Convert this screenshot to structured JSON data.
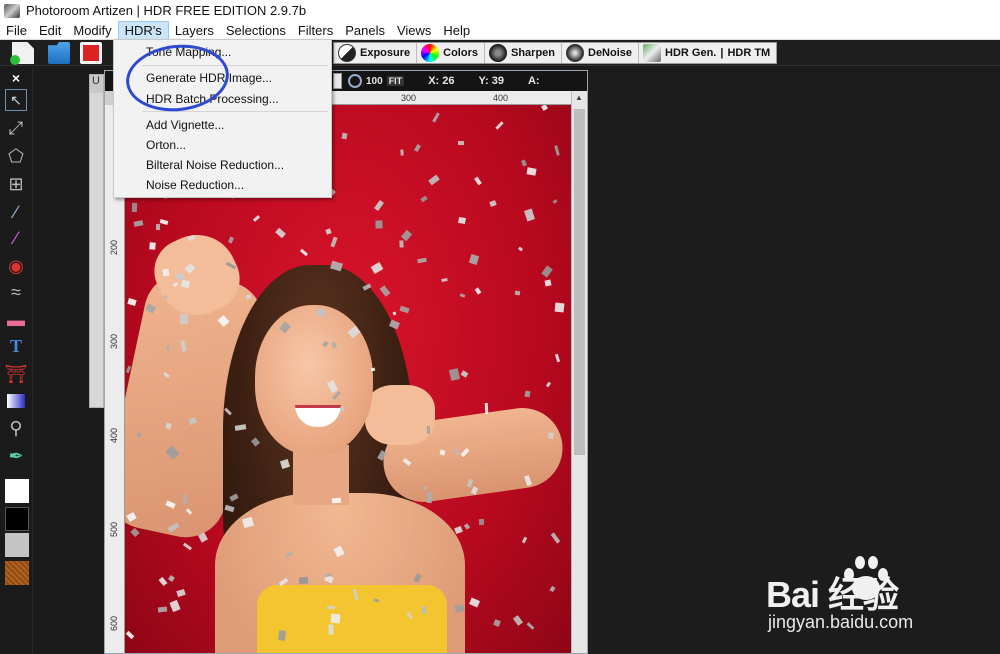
{
  "window": {
    "title": "Photoroom Artizen | HDR FREE EDITION 2.9.7b"
  },
  "menubar": {
    "items": [
      "File",
      "Edit",
      "Modify",
      "HDR's",
      "Layers",
      "Selections",
      "Filters",
      "Panels",
      "Views",
      "Help"
    ],
    "active": "HDR's"
  },
  "hdr_menu": {
    "items": [
      "Tone Mapping...",
      "Generate HDR Image...",
      "HDR Batch Processing...",
      "Add Vignette...",
      "Orton...",
      "Bilteral Noise Reduction...",
      "Noise Reduction..."
    ],
    "highlighted": "Generate HDR Image..."
  },
  "adjustments": {
    "exposure": "Exposure",
    "colors": "Colors",
    "sharpen": "Sharpen",
    "denoise": "DeNoise",
    "hdr_gen": "HDR Gen.",
    "separator": "|",
    "hdr_tm": "HDR TM"
  },
  "image_window": {
    "zoom": "100",
    "fit": "FIT",
    "x": "X: 26",
    "y": "Y: 39",
    "a": "A:",
    "ruler_h": [
      "300",
      "400"
    ],
    "ruler_v": [
      "200",
      "300",
      "400",
      "500",
      "600"
    ]
  },
  "tools": {
    "close": "×",
    "text_tool": "T"
  },
  "colors": {
    "foreground": "#ffffff",
    "background": "#000000",
    "annotation": "#2d4ad0"
  },
  "watermark": {
    "brand": "Bai  经验",
    "url": "jingyan.baidu.com"
  }
}
